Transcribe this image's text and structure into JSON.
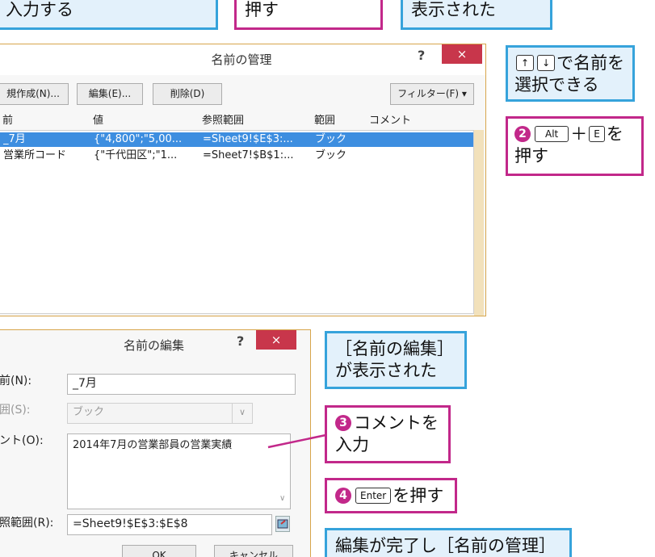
{
  "callouts": {
    "top1": "入力する",
    "top2": "押す",
    "top3": "表示された",
    "arrow_select": {
      "key_up": "↑",
      "key_down": "↓",
      "line1_suffix": "で名前を",
      "line2": "選択できる"
    },
    "alt_e": {
      "number": "2",
      "key_alt": "Alt",
      "plus": "＋",
      "key_e": "E",
      "suffix": "を",
      "line2": "押す"
    },
    "edit_shown": {
      "line1": "［名前の編集］",
      "line2": "が表示された"
    },
    "comment_input": {
      "number": "3",
      "line1": "コメントを",
      "line2": "入力"
    },
    "enter": {
      "number": "4",
      "key": "Enter",
      "suffix": "を押す"
    },
    "done": "編集が完了し［名前の管理］"
  },
  "name_manager": {
    "title": "名前の管理",
    "help": "?",
    "close": "×",
    "buttons": {
      "new": "規作成(N)...",
      "edit": "編集(E)...",
      "delete": "削除(D)",
      "filter": "フィルター(F) ▾"
    },
    "columns": [
      "前",
      "値",
      "参照範囲",
      "範囲",
      "コメント"
    ],
    "rows": [
      {
        "name": "_7月",
        "value": "{\"4,800\";\"5,00...",
        "ref": "=Sheet9!$E$3:...",
        "scope": "ブック",
        "comment": ""
      },
      {
        "name": "営業所コード",
        "value": "{\"千代田区\";\"1...",
        "ref": "=Sheet7!$B$1:...",
        "scope": "ブック",
        "comment": ""
      }
    ]
  },
  "edit_name": {
    "title": "名前の編集",
    "help": "?",
    "close": "×",
    "labels": {
      "name": "前(N):",
      "scope": "囲(S):",
      "comment": "ント(O):",
      "ref": "照範囲(R):"
    },
    "values": {
      "name": "_7月",
      "scope": "ブック",
      "comment": "2014年7月の営業部員の営業実績",
      "ref": "=Sheet9!$E$3:$E$8"
    },
    "buttons": {
      "ok": "OK",
      "cancel": "キャンセル"
    }
  }
}
